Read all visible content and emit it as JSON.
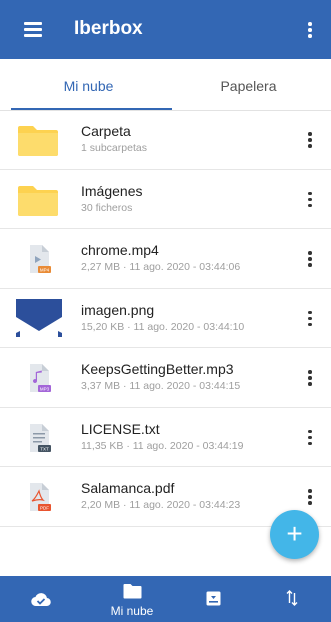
{
  "app": {
    "title": "Iberbox"
  },
  "tabs": [
    {
      "label": "Mi nube",
      "active": true
    },
    {
      "label": "Papelera",
      "active": false
    }
  ],
  "files": [
    {
      "name": "Carpeta",
      "meta": "1 subcarpetas",
      "icon": "folder-icon"
    },
    {
      "name": "Imágenes",
      "meta": "30 ficheros",
      "icon": "folder-icon"
    },
    {
      "name": "chrome.mp4",
      "meta": "2,27 MB · 11 ago. 2020 - 03:44:06",
      "icon": "video-file-icon",
      "badge": "MP4"
    },
    {
      "name": "imagen.png",
      "meta": "15,20 KB · 11 ago. 2020 - 03:44:10",
      "icon": "image-thumbnail"
    },
    {
      "name": "KeepsGettingBetter.mp3",
      "meta": "3,37 MB · 11 ago. 2020 - 03:44:15",
      "icon": "audio-file-icon",
      "badge": "MP3"
    },
    {
      "name": "LICENSE.txt",
      "meta": "11,35 KB · 11 ago. 2020 - 03:44:19",
      "icon": "text-file-icon",
      "badge": "TXT"
    },
    {
      "name": "Salamanca.pdf",
      "meta": "2,20 MB · 11 ago. 2020 - 03:44:23",
      "icon": "pdf-file-icon",
      "badge": "PDF"
    }
  ],
  "fab": {
    "label": "+",
    "icon": "add-icon"
  },
  "bottom_nav": [
    {
      "icon": "cloud-check-icon",
      "label": ""
    },
    {
      "icon": "folder-icon",
      "label": "Mi nube",
      "active": true
    },
    {
      "icon": "inbox-download-icon",
      "label": ""
    },
    {
      "icon": "sort-arrows-icon",
      "label": ""
    }
  ],
  "colors": {
    "primary": "#3367b4",
    "folder": "#fdd250",
    "fab": "#43b6e8",
    "mp4_badge": "#e98b36",
    "mp3_badge": "#a366d8",
    "txt_badge": "#455463",
    "pdf_badge": "#e8542f"
  }
}
